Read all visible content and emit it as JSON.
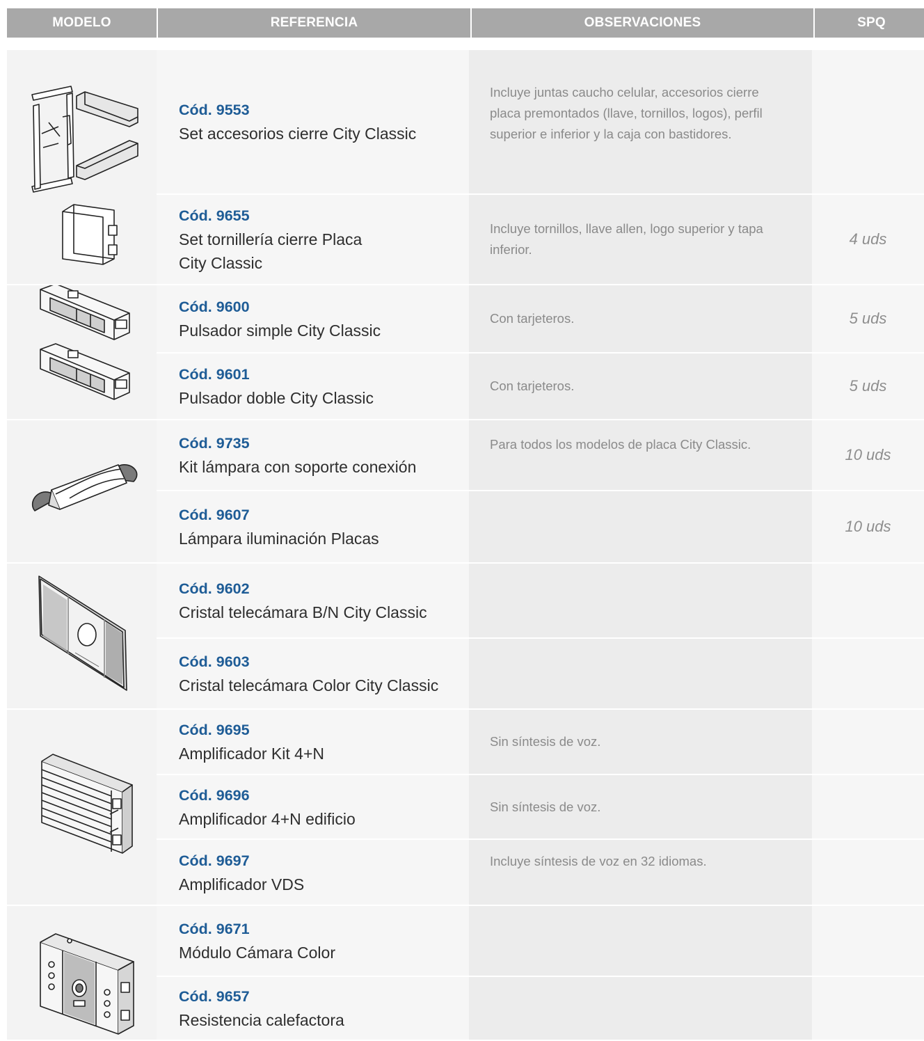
{
  "header": {
    "modelo": "MODELO",
    "referencia": "REFERENCIA",
    "observaciones": "OBSERVACIONES",
    "spq": "SPQ"
  },
  "rows": [
    {
      "code": "Cód. 9553",
      "desc": "Set accesorios cierre City Classic",
      "obs": "Incluye juntas caucho celular, accesorios cierre placa premontados (llave, tornillos, logos), perfil superior e inferior y la caja con bastidores.",
      "spq": ""
    },
    {
      "code": "Cód. 9655",
      "desc": "Set tornillería cierre Placa City Classic",
      "obs": "Incluye tornillos, llave allen, logo superior y tapa inferior.",
      "spq": "4 uds"
    },
    {
      "code": "Cód. 9600",
      "desc": "Pulsador simple City Classic",
      "obs": "Con tarjeteros.",
      "spq": "5 uds"
    },
    {
      "code": "Cód. 9601",
      "desc": "Pulsador doble City Classic",
      "obs": "Con tarjeteros.",
      "spq": "5 uds"
    },
    {
      "code": "Cód. 9735",
      "desc": "Kit lámpara con soporte conexión",
      "obs": "Para todos los modelos de placa City Classic.",
      "spq": "10 uds"
    },
    {
      "code": "Cód. 9607",
      "desc": "Lámpara iluminación Placas",
      "obs": "",
      "spq": "10 uds"
    },
    {
      "code": "Cód. 9602",
      "desc": "Cristal telecámara B/N City Classic",
      "obs": "",
      "spq": ""
    },
    {
      "code": "Cód. 9603",
      "desc": "Cristal telecámara Color City Classic",
      "obs": "",
      "spq": ""
    },
    {
      "code": "Cód. 9695",
      "desc": "Amplificador Kit 4+N",
      "obs": "Sin síntesis de voz.",
      "spq": ""
    },
    {
      "code": "Cód. 9696",
      "desc": "Amplificador 4+N edificio",
      "obs": "Sin síntesis de voz.",
      "spq": ""
    },
    {
      "code": "Cód. 9697",
      "desc": "Amplificador VDS",
      "obs": "Incluye síntesis de voz en 32 idiomas.",
      "spq": ""
    },
    {
      "code": "Cód. 9671",
      "desc": "Módulo Cámara Color",
      "obs": "",
      "spq": ""
    },
    {
      "code": "Cód. 9657",
      "desc": "Resistencia calefactora",
      "obs": "",
      "spq": ""
    }
  ],
  "images": {
    "g1": "closure-accessories-set-illustration",
    "g2": "push-button-modules-illustration",
    "g3": "lamp-kit-illustration",
    "g4": "camera-glass-illustration",
    "g5": "amplifier-module-illustration",
    "g6": "camera-module-illustration"
  }
}
